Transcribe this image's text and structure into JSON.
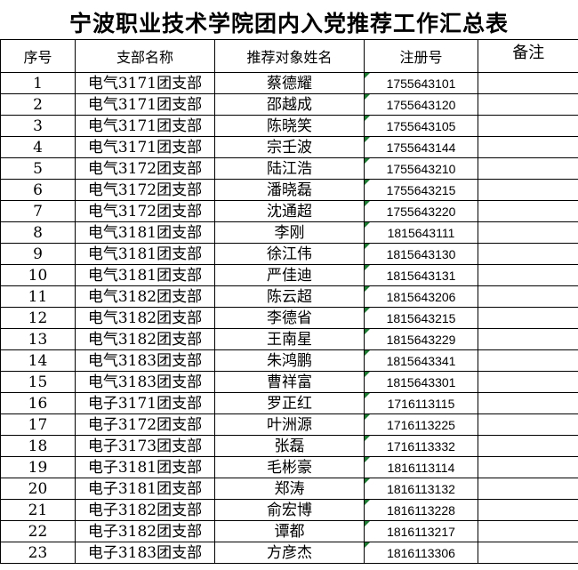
{
  "title": "宁波职业技术学院团内入党推荐工作汇总表",
  "columns": {
    "seq": "序号",
    "branch": "支部名称",
    "name": "推荐对象姓名",
    "reg": "注册号",
    "note": "备注"
  },
  "colors": {
    "cell_marker": "#1e7b34",
    "grid": "#000000"
  },
  "rows": [
    {
      "seq": "1",
      "branch": "电气3171团支部",
      "name": "蔡德耀",
      "reg": "1755643101",
      "note": ""
    },
    {
      "seq": "2",
      "branch": "电气3171团支部",
      "name": "邵越成",
      "reg": "1755643120",
      "note": ""
    },
    {
      "seq": "3",
      "branch": "电气3171团支部",
      "name": "陈晓笑",
      "reg": "1755643105",
      "note": ""
    },
    {
      "seq": "4",
      "branch": "电气3171团支部",
      "name": "宗壬波",
      "reg": "1755643144",
      "note": ""
    },
    {
      "seq": "5",
      "branch": "电气3172团支部",
      "name": "陆江浩",
      "reg": "1755643210",
      "note": ""
    },
    {
      "seq": "6",
      "branch": "电气3172团支部",
      "name": "潘晓磊",
      "reg": "1755643215",
      "note": ""
    },
    {
      "seq": "7",
      "branch": "电气3172团支部",
      "name": "沈通超",
      "reg": "1755643220",
      "note": ""
    },
    {
      "seq": "8",
      "branch": "电气3181团支部",
      "name": "李刚",
      "reg": "1815643111",
      "note": ""
    },
    {
      "seq": "9",
      "branch": "电气3181团支部",
      "name": "徐江伟",
      "reg": "1815643130",
      "note": ""
    },
    {
      "seq": "10",
      "branch": "电气3181团支部",
      "name": "严佳迪",
      "reg": "1815643131",
      "note": ""
    },
    {
      "seq": "11",
      "branch": "电气3182团支部",
      "name": "陈云超",
      "reg": "1815643206",
      "note": ""
    },
    {
      "seq": "12",
      "branch": "电气3182团支部",
      "name": "李德省",
      "reg": "1815643215",
      "note": ""
    },
    {
      "seq": "13",
      "branch": "电气3182团支部",
      "name": "王南星",
      "reg": "1815643229",
      "note": ""
    },
    {
      "seq": "14",
      "branch": "电气3183团支部",
      "name": "朱鸿鹏",
      "reg": "1815643341",
      "note": ""
    },
    {
      "seq": "15",
      "branch": "电气3183团支部",
      "name": "曹祥富",
      "reg": "1815643301",
      "note": ""
    },
    {
      "seq": "16",
      "branch": "电子3171团支部",
      "name": "罗正红",
      "reg": "1716113115",
      "note": ""
    },
    {
      "seq": "17",
      "branch": "电子3172团支部",
      "name": "叶洲源",
      "reg": "1716113225",
      "note": ""
    },
    {
      "seq": "18",
      "branch": "电子3173团支部",
      "name": "张磊",
      "reg": "1716113332",
      "note": ""
    },
    {
      "seq": "19",
      "branch": "电子3181团支部",
      "name": "毛彬豪",
      "reg": "1816113114",
      "note": ""
    },
    {
      "seq": "20",
      "branch": "电子3181团支部",
      "name": "郑涛",
      "reg": "1816113132",
      "note": ""
    },
    {
      "seq": "21",
      "branch": "电子3182团支部",
      "name": "俞宏博",
      "reg": "1816113228",
      "note": ""
    },
    {
      "seq": "22",
      "branch": "电子3182团支部",
      "name": "谭都",
      "reg": "1816113217",
      "note": ""
    },
    {
      "seq": "23",
      "branch": "电子3183团支部",
      "name": "方彦杰",
      "reg": "1816113306",
      "note": ""
    }
  ]
}
